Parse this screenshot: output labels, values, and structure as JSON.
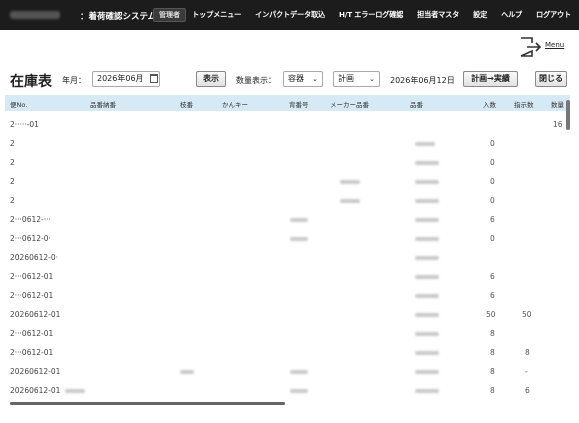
{
  "header": {
    "app_title": "：着荷確認システム",
    "role_badge": "管理者",
    "nav": [
      "トップメニュー",
      "インパクトデータ取込",
      "H/T エラーログ確認",
      "担当者マスタ",
      "設定",
      "ヘルプ",
      "ログアウト"
    ]
  },
  "menu": {
    "label": "Menu",
    "icon": "menu-exit-icon"
  },
  "toolbar": {
    "title": "在庫表",
    "ym_label": "年月：",
    "ym_value": "2026年06月",
    "show_button": "表示",
    "qty_label": "数量表示：",
    "unit_select": "容器",
    "plan_select": "計画",
    "date_text": "2026年06月12日",
    "plan_to_actual_button": "計画→実績",
    "close_button": "閉じる"
  },
  "table": {
    "headers": [
      "便No.",
      "品番納番",
      "枝番",
      "かんキー",
      "背番号",
      "メーカー品番",
      "品番",
      "入数",
      "指示数",
      "数量"
    ],
    "rows": [
      {
        "lot": "2·····-01",
        "qty": "",
        "inst": "",
        "amount": "16"
      },
      {
        "lot": "2",
        "qty": "0",
        "inst": "",
        "amount": ""
      },
      {
        "lot": "2",
        "qty": "0",
        "inst": "",
        "amount": ""
      },
      {
        "lot": "2",
        "qty": "0",
        "inst": "",
        "amount": ""
      },
      {
        "lot": "2",
        "qty": "0",
        "inst": "",
        "amount": ""
      },
      {
        "lot": "2···0612-···",
        "qty": "6",
        "inst": "",
        "amount": ""
      },
      {
        "lot": "2···0612-0·",
        "qty": "0",
        "inst": "",
        "amount": ""
      },
      {
        "lot": "20260612-0·",
        "qty": "",
        "inst": "",
        "amount": ""
      },
      {
        "lot": "2···0612-01",
        "qty": "6",
        "inst": "",
        "amount": ""
      },
      {
        "lot": "2···0612-01",
        "qty": "6",
        "inst": "",
        "amount": ""
      },
      {
        "lot": "20260612-01",
        "qty": "50",
        "inst": "50",
        "amount": ""
      },
      {
        "lot": "2···0612-01",
        "qty": "8",
        "inst": "",
        "amount": ""
      },
      {
        "lot": "2···0612-01",
        "qty": "8",
        "inst": "8",
        "amount": ""
      },
      {
        "lot": "20260612-01",
        "qty": "8",
        "inst": "-",
        "amount": ""
      },
      {
        "lot": "20260612-01",
        "qty": "8",
        "inst": "6",
        "amount": ""
      }
    ]
  }
}
